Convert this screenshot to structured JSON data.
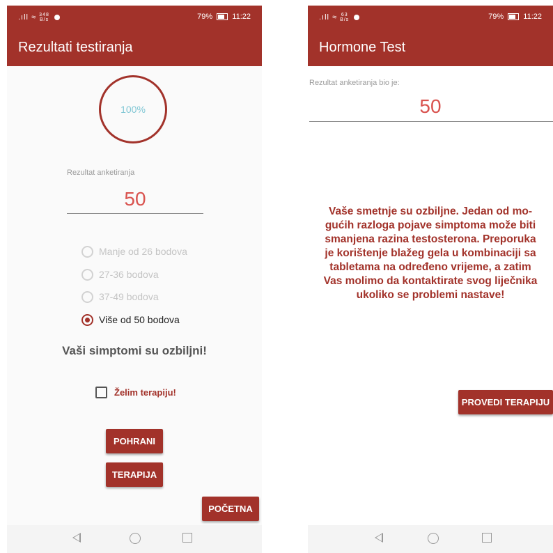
{
  "status_left": {
    "net_speed_a": "348",
    "net_speed_b": "63",
    "net_unit": "B/s"
  },
  "status_right": {
    "battery": "79%",
    "time": "11:22"
  },
  "colors": {
    "primary": "#a2322a",
    "score": "#d9534f",
    "progress_text": "#7fc6d4"
  },
  "screen_results": {
    "title": "Rezultati testiranja",
    "progress_text": "100%",
    "progress_value": 100,
    "score_label": "Rezultat anketiranja",
    "score_value": "50",
    "options": [
      {
        "label": "Manje od 26 bodova",
        "selected": false
      },
      {
        "label": "27-36 bodova",
        "selected": false
      },
      {
        "label": "37-49 bodova",
        "selected": false
      },
      {
        "label": "Više od 50 bodova",
        "selected": true
      }
    ],
    "symptoms_text": "Vaši simptomi su ozbiljni!",
    "therapy_checkbox": {
      "label": "Želim terapiju!",
      "checked": false
    },
    "save_button": "POHRANI",
    "therapy_button": "TERAPIJA",
    "home_button": "POČETNA"
  },
  "screen_hormone": {
    "title": "Hormone Test",
    "score_label": "Rezultat anketiranja bio je:",
    "score_value": "50",
    "message_lines": [
      "Vaše smetnje su ozbiljne. Jedan od mo-",
      "gućih razloga pojave simptoma može biti",
      "smanjena razina testosterona. Preporuka",
      "je korištenje blažeg gela u kombinaciji sa",
      "tabletama na određeno vrijeme, a zatim",
      "Vas molimo da kontaktirate svog liječnika",
      "ukoliko se problemi nastave!"
    ],
    "therapy_button": "PROVEDI TERAPIJU"
  },
  "navbar_icons": [
    "back-icon",
    "home-icon",
    "recent-apps-icon"
  ]
}
